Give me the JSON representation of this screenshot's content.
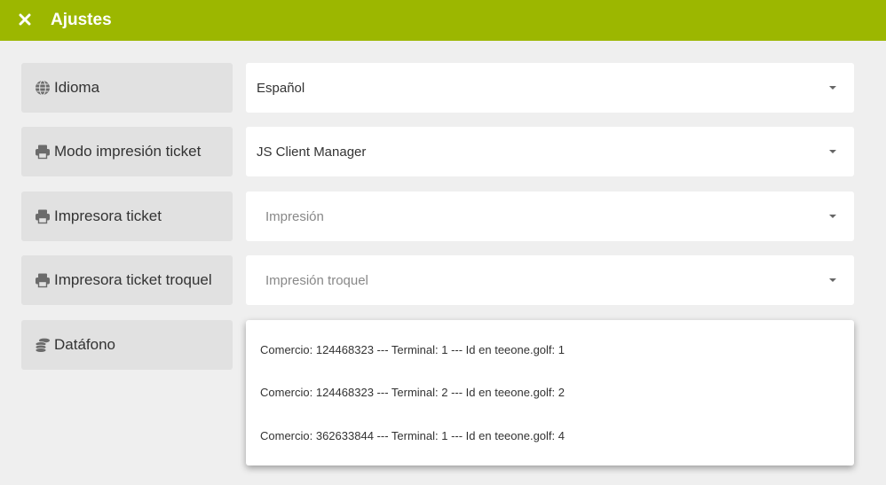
{
  "header": {
    "title": "Ajustes",
    "close_icon": "close-icon",
    "bg_color": "#9cb700"
  },
  "settings": [
    {
      "label": "Idioma",
      "icon": "globe-icon",
      "value": "Español",
      "placeholder": ""
    },
    {
      "label": "Modo impresión ticket",
      "icon": "printer-icon",
      "value": "JS Client Manager",
      "placeholder": ""
    },
    {
      "label": "Impresora ticket",
      "icon": "printer-icon",
      "value": "",
      "placeholder": "Impresión"
    },
    {
      "label": "Impresora ticket troquel",
      "icon": "printer-icon",
      "value": "",
      "placeholder": "Impresión troquel"
    },
    {
      "label": "Datáfono",
      "icon": "coins-icon",
      "value": "",
      "placeholder": ""
    }
  ],
  "datafono_options": [
    "Comercio: 124468323 --- Terminal: 1 --- Id en teeone.golf: 1",
    "Comercio: 124468323 --- Terminal: 2 --- Id en teeone.golf: 2",
    "Comercio: 362633844 --- Terminal: 1 --- Id en teeone.golf: 4"
  ]
}
